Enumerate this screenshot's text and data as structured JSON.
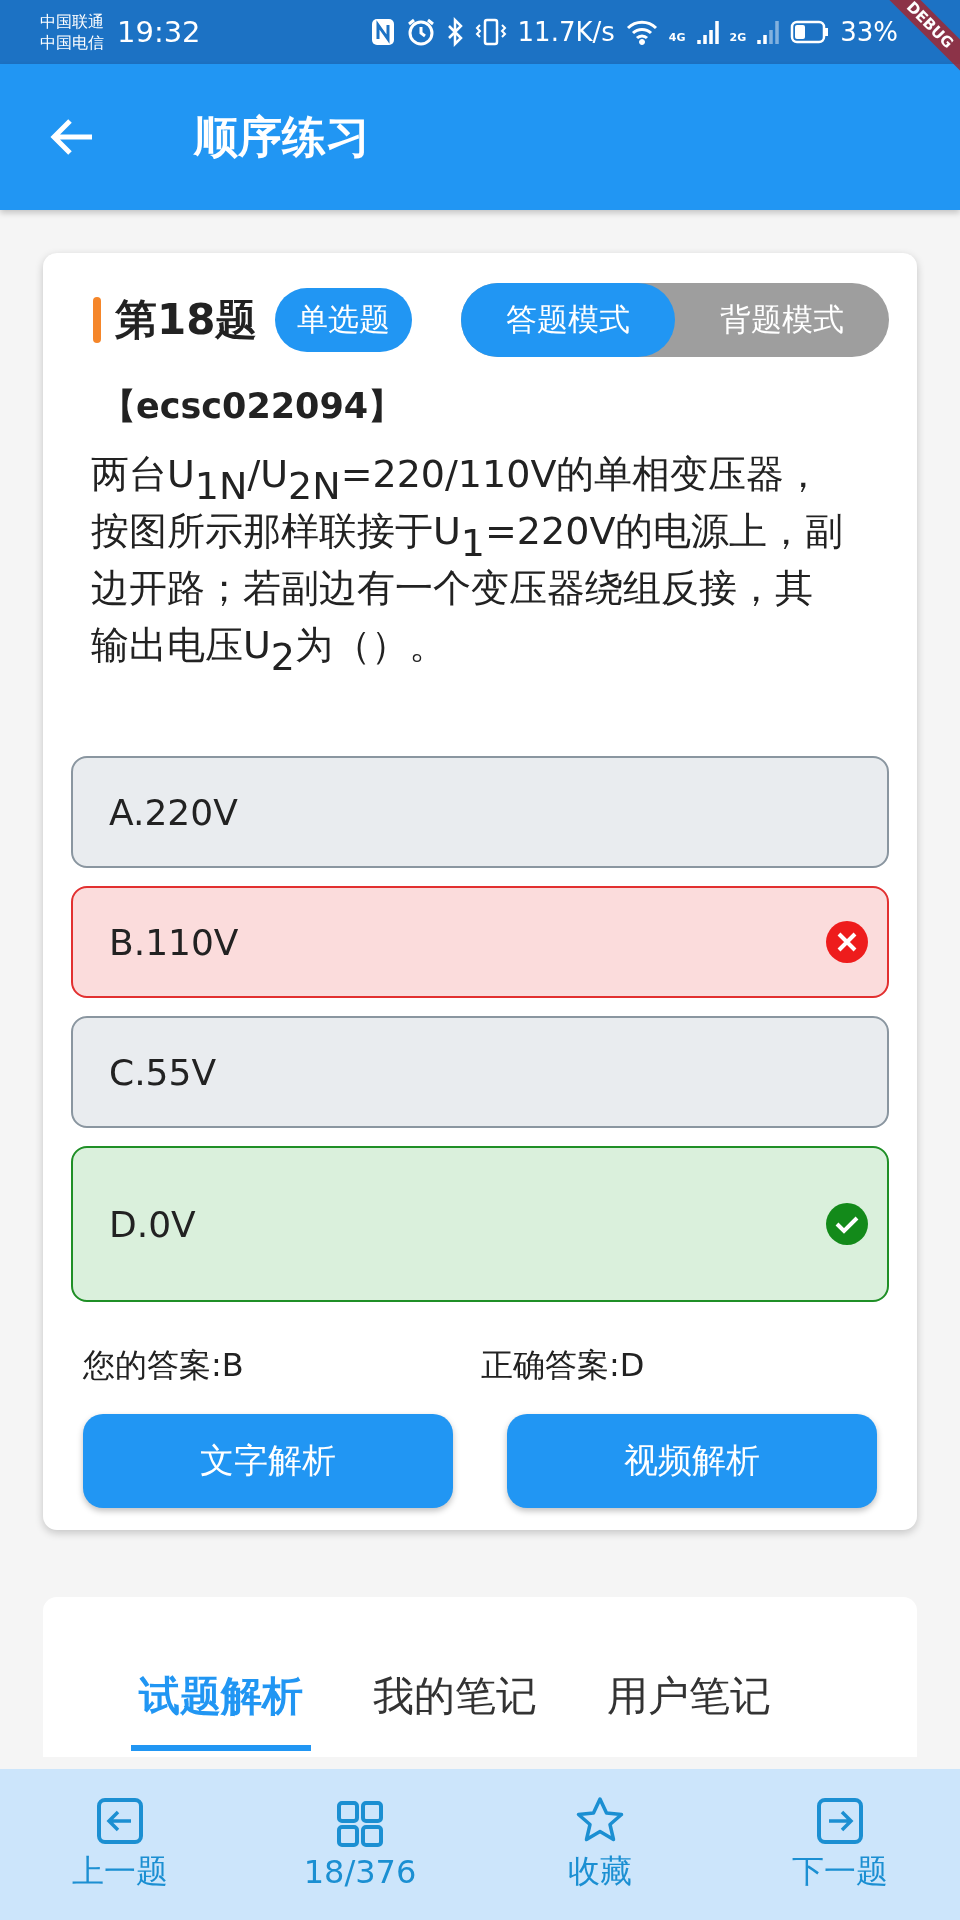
{
  "status_bar": {
    "carriers": [
      "中国联通",
      "中国电信"
    ],
    "time": "19:32",
    "net_speed": "11.7K/s",
    "net_4g": "4G",
    "net_2g": "2G",
    "battery": "33%"
  },
  "debug_banner": "DEBUG",
  "app_bar": {
    "title": "顺序练习"
  },
  "question": {
    "number": "第18题",
    "type_chip": "单选题",
    "modes": [
      {
        "label": "答题模式",
        "selected": true
      },
      {
        "label": "背题模式",
        "selected": false
      }
    ],
    "code": "【ecsc022094】",
    "text": "两台U$_{1N}$/U$_{2N}$=220/110V的单相变压器，按图所示那样联接于U$_{1}$=220V的电源上，副边开路；若副边有一个变压器绕组反接，其输出电压U$_{2}$为（）。",
    "options": [
      {
        "label": "A.220V",
        "selected": false,
        "correct": false
      },
      {
        "label": "B.110V",
        "selected": true,
        "correct": false
      },
      {
        "label": "C.55V",
        "selected": false,
        "correct": false
      },
      {
        "label": "D.0V",
        "selected": false,
        "correct": true
      }
    ],
    "your_answer": "您的答案:B",
    "correct_answer": "正确答案:D",
    "buttons": [
      "文字解析",
      "视频解析"
    ]
  },
  "analysis_tabs": [
    {
      "label": "试题解析",
      "selected": true
    },
    {
      "label": "我的笔记",
      "selected": false
    },
    {
      "label": "用户笔记",
      "selected": false
    }
  ],
  "bottom_nav": [
    {
      "kind": "prev",
      "label": "上一题"
    },
    {
      "kind": "grid",
      "label": "18/376"
    },
    {
      "kind": "star",
      "label": "收藏"
    },
    {
      "kind": "next",
      "label": "下一题"
    }
  ]
}
